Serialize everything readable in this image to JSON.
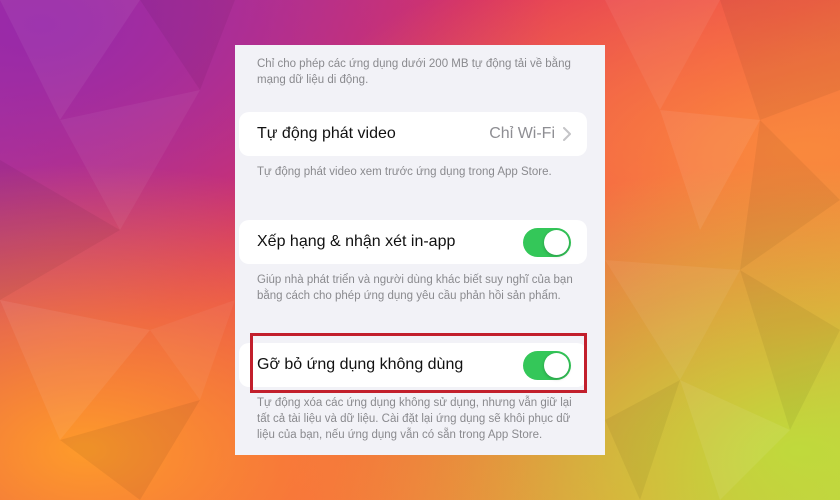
{
  "settings": {
    "cellular_footer": "Chỉ cho phép các ứng dụng dưới 200 MB tự động tải về bằng mạng dữ liệu di động.",
    "autoplay": {
      "label": "Tự động phát video",
      "value": "Chỉ Wi-Fi",
      "footer": "Tự động phát video xem trước ứng dụng trong App Store."
    },
    "ratings": {
      "label": "Xếp hạng & nhận xét in-app",
      "on": true,
      "footer": "Giúp nhà phát triển và người dùng khác biết suy nghĩ của bạn bằng cách cho phép ứng dụng yêu cầu phản hồi sản phẩm."
    },
    "offload": {
      "label": "Gỡ bỏ ứng dụng không dùng",
      "on": true,
      "footer": "Tự động xóa các ứng dụng không sử dụng, nhưng vẫn giữ lại tất cả tài liệu và dữ liệu. Cài đặt lại ứng dụng sẽ khôi phục dữ liệu của bạn, nếu ứng dụng vẫn có sẵn trong App Store."
    }
  },
  "colors": {
    "toggle_on": "#34c759",
    "highlight_border": "#c21f2c",
    "panel_bg": "#f2f2f7"
  },
  "icons": {
    "disclosure": "chevron-right-icon"
  }
}
